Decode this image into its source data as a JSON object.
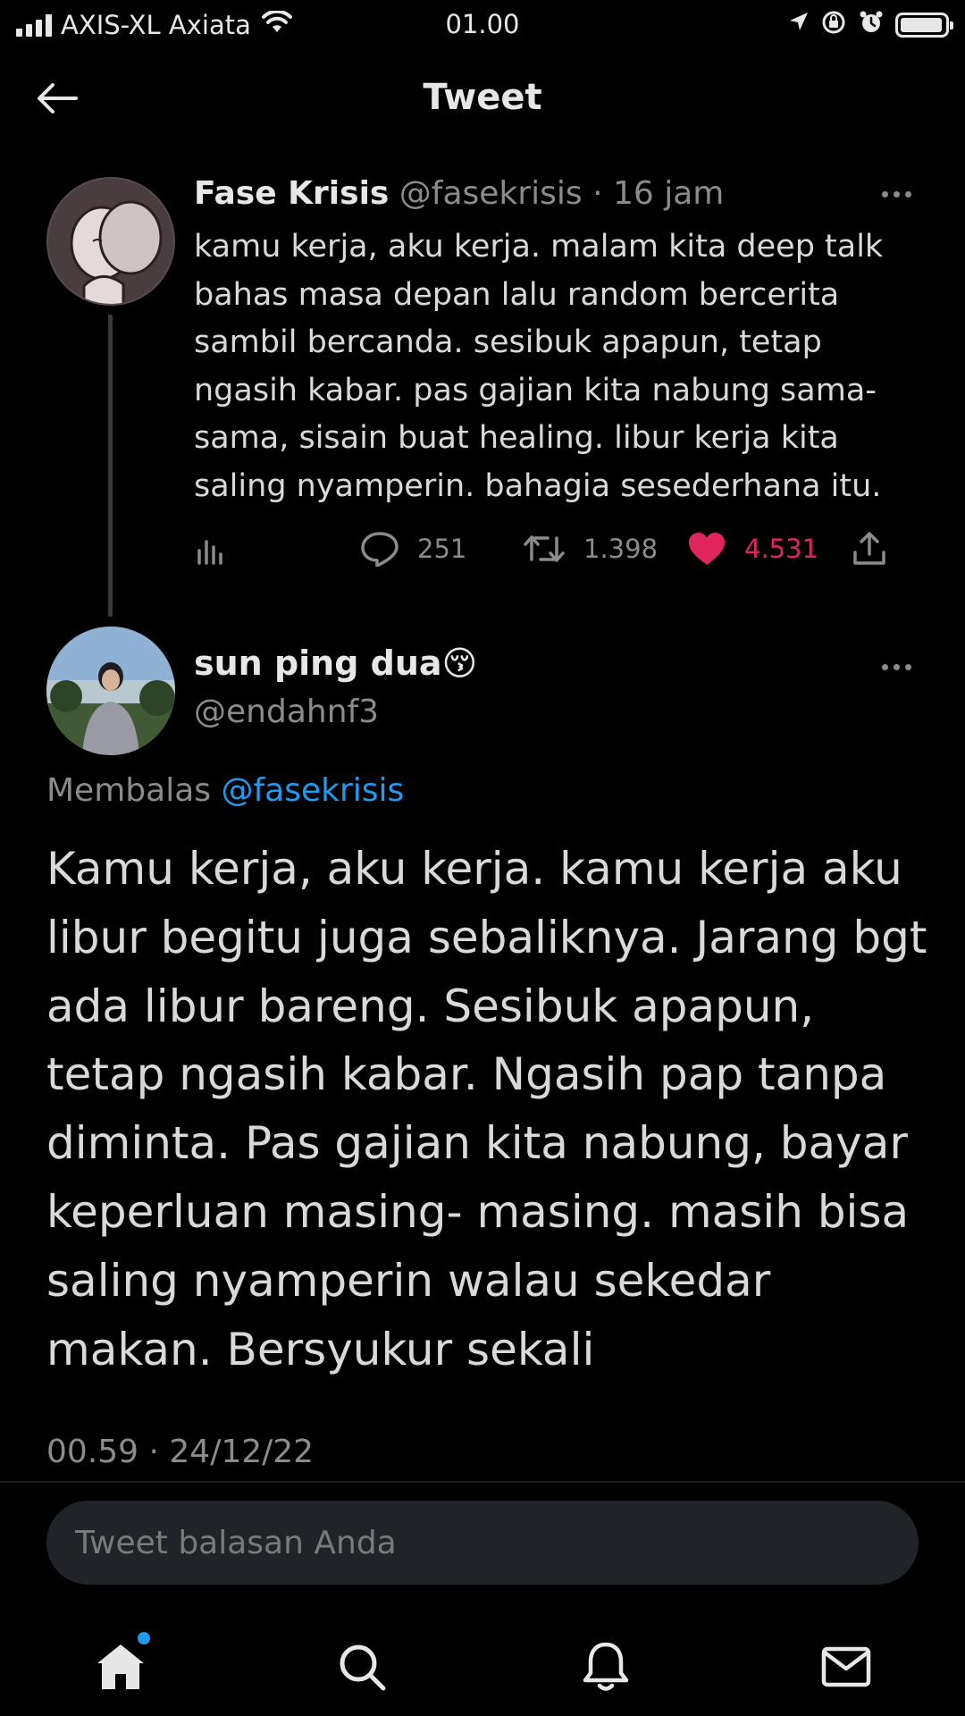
{
  "status_bar": {
    "carrier": "AXIS-XL Axiata",
    "time": "01.00",
    "battery_level": 0.95
  },
  "header": {
    "title": "Tweet"
  },
  "parent_tweet": {
    "name": "Fase Krisis",
    "handle": "@fasekrisis",
    "separator": "·",
    "age": "16 jam",
    "text": "kamu kerja, aku kerja. malam kita deep talk bahas masa depan lalu random bercerita sambil bercanda. sesibuk apapun, tetap ngasih kabar. pas gajian kita nabung sama-sama, sisain buat healing. libur kerja kita saling nyamperin. bahagia sesederhana itu.",
    "replies": "251",
    "retweets": "1.398",
    "likes": "4.531",
    "like_color": "#e0245e"
  },
  "reply_tweet": {
    "name": "sun ping dua",
    "emoji": "😚",
    "handle": "@endahnf3",
    "replying_label": "Membalas",
    "replying_to": "@fasekrisis",
    "text": "Kamu kerja, aku kerja. kamu kerja aku libur begitu juga sebaliknya. Jarang bgt ada libur bareng. Sesibuk apapun, tetap ngasih kabar. Ngasih pap tanpa diminta. Pas gajian kita nabung, bayar keperluan masing- masing. masih bisa saling nyamperin walau sekedar makan. Bersyukur sekali",
    "timestamp": "00.59 · 24/12/22"
  },
  "reply_box": {
    "placeholder": "Tweet balasan Anda"
  },
  "bottom_nav": {
    "items": [
      "home-icon",
      "search-icon",
      "bell-icon",
      "mail-icon"
    ],
    "accent": "#1d9bf0"
  }
}
